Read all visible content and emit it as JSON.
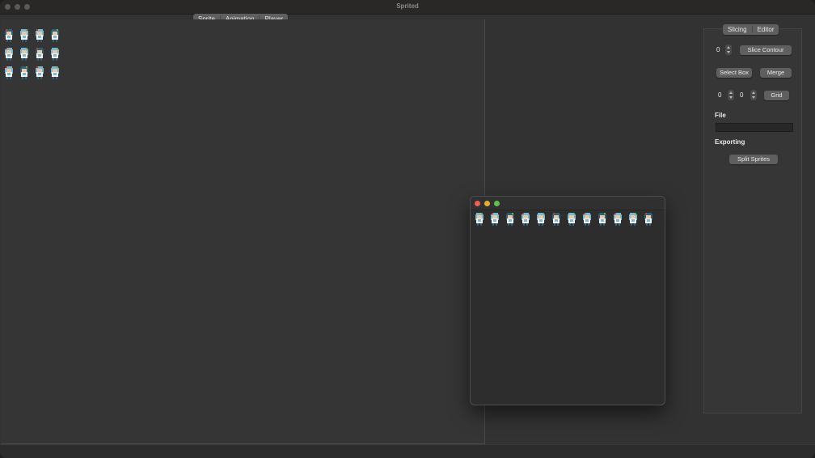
{
  "window": {
    "title": "Sprited"
  },
  "main_tabs": [
    {
      "label": "Sprite"
    },
    {
      "label": "Animation"
    },
    {
      "label": "Player"
    }
  ],
  "colors": {
    "hair_blue": "#7ab7d2",
    "hair_dark": "#2f5f77",
    "skin": "#e9c9a4",
    "cloth_white": "#f0f0f0",
    "red": "#c83a2e",
    "green": "#6cae4c",
    "close_red": "#ec5f57",
    "min_yellow": "#e2ad33",
    "max_green": "#5fc04f"
  },
  "canvas": {
    "sprite_sheet": [
      [
        "sprite-down-1",
        "sprite-down-2",
        "sprite-down-3",
        "sprite-down-4"
      ],
      [
        "sprite-left-1",
        "sprite-left-2",
        "sprite-left-3",
        "sprite-left-4"
      ],
      [
        "sprite-right-1",
        "sprite-right-2",
        "sprite-right-3",
        "sprite-right-4"
      ]
    ]
  },
  "panel": {
    "tabs": [
      {
        "label": "Slicing"
      },
      {
        "label": "Editor"
      }
    ],
    "contour_value": "0",
    "slice_contour_label": "Slice Contour",
    "select_box_label": "Select Box",
    "merge_label": "Merge",
    "grid_x_value": "0",
    "grid_y_value": "0",
    "grid_label": "Grid",
    "file_label": "File",
    "exporting_label": "Exporting",
    "split_sprites_label": "Split Sprites"
  },
  "preview_window": {
    "sprite_count": 12
  }
}
